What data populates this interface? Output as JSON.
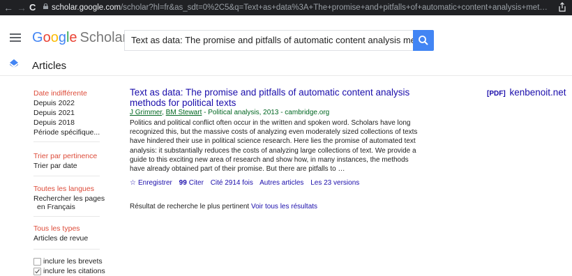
{
  "browser": {
    "back": "←",
    "forward": "→",
    "reload": "C",
    "url_host": "scholar.google.com",
    "url_path": "/scholar?hl=fr&as_sdt=0%2C5&q=Text+as+data%3A+The+promise+and+pitfalls+of+automatic+content+analysis+met…"
  },
  "header": {
    "logo": {
      "g1": "G",
      "o1": "o",
      "o2": "o",
      "g2": "g",
      "l": "l",
      "e": "e",
      "scholar": "Scholar"
    },
    "search_value": "Text as data: The promise and pitfalls of automatic content analysis methods",
    "section_label": "Articles"
  },
  "sidebar": {
    "date_any": "Date indifférente",
    "date_items": [
      "Depuis 2022",
      "Depuis 2021",
      "Depuis 2018",
      "Période spécifique..."
    ],
    "sort_relevance": "Trier par pertinence",
    "sort_date": "Trier par date",
    "lang_any": "Toutes les langues",
    "lang_fr_1": "Rechercher les pages",
    "lang_fr_2": "en Français",
    "types_any": "Tous les types",
    "types_review": "Articles de revue",
    "include_patents": "inclure les brevets",
    "include_citations": "inclure les citations"
  },
  "result": {
    "title": "Text as data: The promise and pitfalls of automatic content analysis methods for political texts",
    "pdf_tag": "[PDF]",
    "pdf_source": "kenbenoit.net",
    "author1": "J Grimmer",
    "author_sep": ", ",
    "author2": "BM Stewart",
    "publication": " - Political analysis, 2013 - cambridge.org",
    "snippet": "Politics and political conflict often occur in the written and spoken word. Scholars have long recognized this, but the massive costs of analyzing even moderately sized collections of texts have hindered their use in political science research. Here lies the promise of automated text analysis: it substantially reduces the costs of analyzing large collections of text. We provide a guide to this exciting new area of research and show how, in many instances, the methods have already obtained part of their promise. But there are pitfalls to …",
    "save": "Enregistrer",
    "cite": "Citer",
    "cited_by": "Cité 2914 fois",
    "related": "Autres articles",
    "versions": "Les 23 versions"
  },
  "footer_note": {
    "text": "Résultat de recherche le plus pertinent ",
    "link": "Voir tous les résultats"
  }
}
